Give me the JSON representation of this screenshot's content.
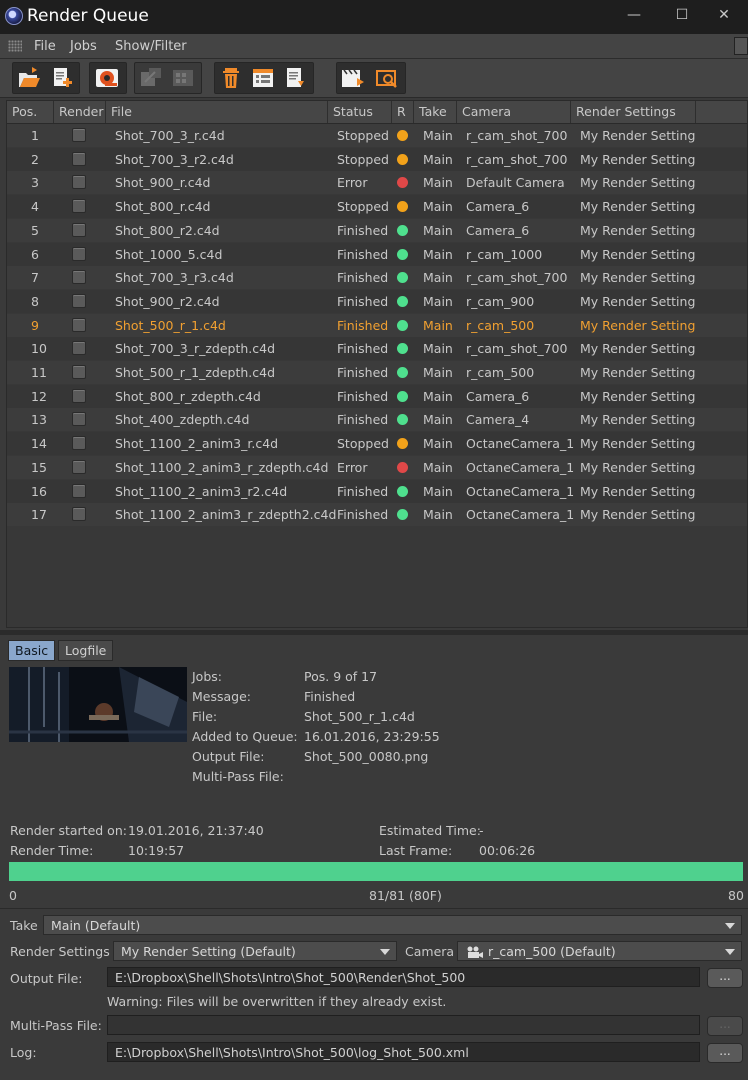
{
  "window": {
    "title": "Render Queue",
    "controls": {
      "minimize": "—",
      "maximize": "☐",
      "close": "✕"
    }
  },
  "menu": [
    "File",
    "Jobs",
    "Show/Filter"
  ],
  "toolbar": {
    "icons": [
      "open-folder-icon",
      "add-job-icon",
      "render-icon",
      "disabled-tool-icon",
      "disabled-tool-icon-2",
      "delete-job-icon",
      "job-list-icon",
      "job-report-icon",
      "clapper-render-icon",
      "picture-viewer-icon"
    ]
  },
  "table": {
    "headers": [
      "Pos.",
      "Render",
      "File",
      "Status",
      "R",
      "Take",
      "Camera",
      "Render Settings"
    ],
    "selected_pos": "9",
    "rows": [
      {
        "pos": "1",
        "file": "Shot_700_3_r.c4d",
        "status": "Stopped",
        "take": "Main",
        "camera": "r_cam_shot_700",
        "settings": "My Render Setting"
      },
      {
        "pos": "2",
        "file": "Shot_700_3_r2.c4d",
        "status": "Stopped",
        "take": "Main",
        "camera": "r_cam_shot_700",
        "settings": "My Render Setting"
      },
      {
        "pos": "3",
        "file": "Shot_900_r.c4d",
        "status": "Error",
        "take": "Main",
        "camera": "Default Camera",
        "settings": "My Render Setting"
      },
      {
        "pos": "4",
        "file": "Shot_800_r.c4d",
        "status": "Stopped",
        "take": "Main",
        "camera": "Camera_6",
        "settings": "My Render Setting"
      },
      {
        "pos": "5",
        "file": "Shot_800_r2.c4d",
        "status": "Finished",
        "take": "Main",
        "camera": "Camera_6",
        "settings": "My Render Setting"
      },
      {
        "pos": "6",
        "file": "Shot_1000_5.c4d",
        "status": "Finished",
        "take": "Main",
        "camera": "r_cam_1000",
        "settings": "My Render Setting"
      },
      {
        "pos": "7",
        "file": "Shot_700_3_r3.c4d",
        "status": "Finished",
        "take": "Main",
        "camera": "r_cam_shot_700",
        "settings": "My Render Setting"
      },
      {
        "pos": "8",
        "file": "Shot_900_r2.c4d",
        "status": "Finished",
        "take": "Main",
        "camera": "r_cam_900",
        "settings": "My Render Setting"
      },
      {
        "pos": "9",
        "file": "Shot_500_r_1.c4d",
        "status": "Finished",
        "take": "Main",
        "camera": "r_cam_500",
        "settings": "My Render Setting"
      },
      {
        "pos": "10",
        "file": "Shot_700_3_r_zdepth.c4d",
        "status": "Finished",
        "take": "Main",
        "camera": "r_cam_shot_700",
        "settings": "My Render Setting"
      },
      {
        "pos": "11",
        "file": "Shot_500_r_1_zdepth.c4d",
        "status": "Finished",
        "take": "Main",
        "camera": "r_cam_500",
        "settings": "My Render Setting"
      },
      {
        "pos": "12",
        "file": "Shot_800_r_zdepth.c4d",
        "status": "Finished",
        "take": "Main",
        "camera": "Camera_6",
        "settings": "My Render Setting"
      },
      {
        "pos": "13",
        "file": "Shot_400_zdepth.c4d",
        "status": "Finished",
        "take": "Main",
        "camera": "Camera_4",
        "settings": "My Render Setting"
      },
      {
        "pos": "14",
        "file": "Shot_1100_2_anim3_r.c4d",
        "status": "Stopped",
        "take": "Main",
        "camera": "OctaneCamera_1",
        "settings": "My Render Setting"
      },
      {
        "pos": "15",
        "file": "Shot_1100_2_anim3_r_zdepth.c4d",
        "status": "Error",
        "take": "Main",
        "camera": "OctaneCamera_1",
        "settings": "My Render Setting"
      },
      {
        "pos": "16",
        "file": "Shot_1100_2_anim3_r2.c4d",
        "status": "Finished",
        "take": "Main",
        "camera": "OctaneCamera_1",
        "settings": "My Render Setting"
      },
      {
        "pos": "17",
        "file": "Shot_1100_2_anim3_r_zdepth2.c4d",
        "status": "Finished",
        "take": "Main",
        "camera": "OctaneCamera_1",
        "settings": "My Render Setting"
      }
    ]
  },
  "status_colors": {
    "Stopped": "#f2a21a",
    "Error": "#e04848",
    "Finished": "#4fe08e"
  },
  "tabs": [
    "Basic",
    "Logfile"
  ],
  "details": {
    "jobs_label": "Jobs:",
    "jobs_value": "Pos. 9 of 17",
    "message_label": "Message:",
    "message_value": "Finished",
    "file_label": "File:",
    "file_value": "Shot_500_r_1.c4d",
    "added_label": "Added to Queue:",
    "added_value": "16.01.2016, 23:29:55",
    "output_label": "Output File:",
    "output_value": "Shot_500_0080.png",
    "multipass_label": "Multi-Pass File:"
  },
  "timing": {
    "started_label": "Render started on:",
    "started_value": "19.01.2016, 21:37:40",
    "render_time_label": "Render Time:",
    "render_time_value": "10:19:57",
    "estimated_label": "Estimated Time:",
    "estimated_value": "-",
    "last_frame_label": "Last Frame:",
    "last_frame_value": "00:06:26"
  },
  "progress": {
    "fraction": 1.0,
    "start": "0",
    "center": "81/81 (80F)",
    "end": "80",
    "color": "#4fd18e"
  },
  "settings": {
    "take_label": "Take",
    "take_value": "Main (Default)",
    "render_settings_label": "Render Settings",
    "render_settings_value": "My Render Setting (Default)",
    "camera_label": "Camera",
    "camera_value": "r_cam_500 (Default)",
    "output_label": "Output File:",
    "output_value": "E:\\Dropbox\\Shell\\Shots\\Intro\\Shot_500\\Render\\Shot_500",
    "warning": "Warning: Files will be overwritten if they already exist.",
    "multipass_label": "Multi-Pass File:",
    "multipass_value": "",
    "log_label": "Log:",
    "log_value": "E:\\Dropbox\\Shell\\Shots\\Intro\\Shot_500\\log_Shot_500.xml",
    "browse_label": "..."
  }
}
